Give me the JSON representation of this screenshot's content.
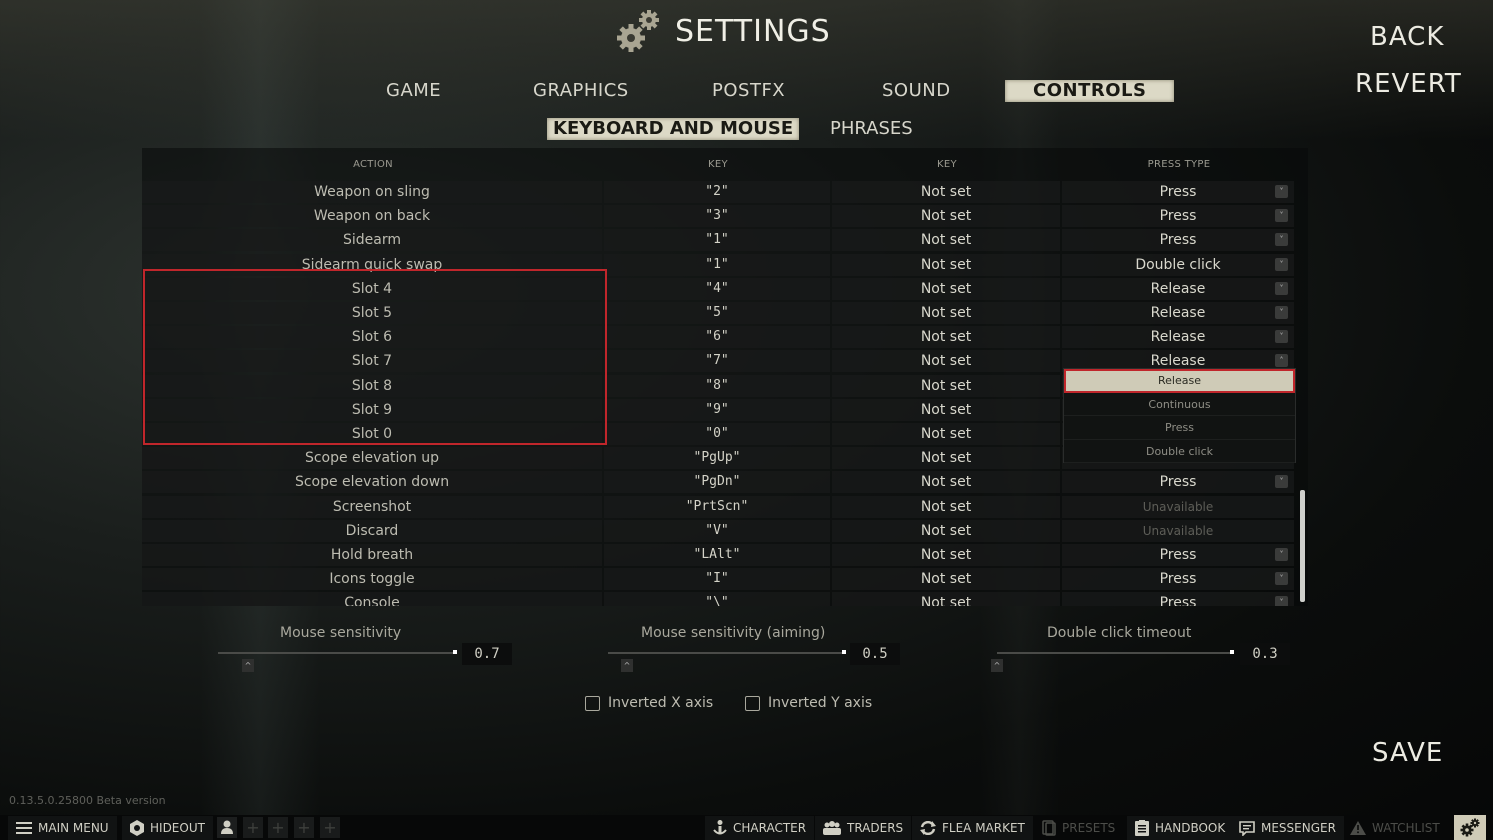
{
  "header": {
    "title": "SETTINGS",
    "icon": "gears-icon"
  },
  "side_actions": {
    "back": "BACK",
    "revert": "REVERT",
    "save": "SAVE"
  },
  "tabs": [
    {
      "label": "GAME",
      "active": false
    },
    {
      "label": "GRAPHICS",
      "active": false
    },
    {
      "label": "POSTFX",
      "active": false
    },
    {
      "label": "SOUND",
      "active": false
    },
    {
      "label": "CONTROLS",
      "active": true
    }
  ],
  "subtabs": [
    {
      "label": "KEYBOARD AND MOUSE",
      "active": true
    },
    {
      "label": "PHRASES",
      "active": false
    }
  ],
  "table": {
    "columns": [
      "ACTION",
      "KEY",
      "KEY",
      "PRESS TYPE"
    ],
    "rows": [
      {
        "action": "Weapon on sling",
        "key1": "\"2\"",
        "key2": "Not set",
        "press": "Press"
      },
      {
        "action": "Weapon on back",
        "key1": "\"3\"",
        "key2": "Not set",
        "press": "Press"
      },
      {
        "action": "Sidearm",
        "key1": "\"1\"",
        "key2": "Not set",
        "press": "Press"
      },
      {
        "action": "Sidearm quick swap",
        "key1": "\"1\"",
        "key2": "Not set",
        "press": "Double click"
      },
      {
        "action": "Slot 4",
        "key1": "\"4\"",
        "key2": "Not set",
        "press": "Release"
      },
      {
        "action": "Slot 5",
        "key1": "\"5\"",
        "key2": "Not set",
        "press": "Release"
      },
      {
        "action": "Slot 6",
        "key1": "\"6\"",
        "key2": "Not set",
        "press": "Release"
      },
      {
        "action": "Slot 7",
        "key1": "\"7\"",
        "key2": "Not set",
        "press": "Release",
        "open": true
      },
      {
        "action": "Slot 8",
        "key1": "\"8\"",
        "key2": "Not set",
        "press": ""
      },
      {
        "action": "Slot 9",
        "key1": "\"9\"",
        "key2": "Not set",
        "press": ""
      },
      {
        "action": "Slot 0",
        "key1": "\"0\"",
        "key2": "Not set",
        "press": ""
      },
      {
        "action": "Scope elevation up",
        "key1": "\"PgUp\"",
        "key2": "Not set",
        "press": ""
      },
      {
        "action": "Scope elevation down",
        "key1": "\"PgDn\"",
        "key2": "Not set",
        "press": "Press"
      },
      {
        "action": "Screenshot",
        "key1": "\"PrtScn\"",
        "key2": "Not set",
        "press": "Unavailable",
        "unavailable": true
      },
      {
        "action": "Discard",
        "key1": "\"V\"",
        "key2": "Not set",
        "press": "Unavailable",
        "unavailable": true
      },
      {
        "action": "Hold breath",
        "key1": "\"LAlt\"",
        "key2": "Not set",
        "press": "Press"
      },
      {
        "action": "Icons toggle",
        "key1": "\"I\"",
        "key2": "Not set",
        "press": "Press"
      },
      {
        "action": "Console",
        "key1": "\"\\\"",
        "key2": "Not set",
        "press": "Press"
      }
    ]
  },
  "dropdown": {
    "options": [
      "Release",
      "Continuous",
      "Press",
      "Double click"
    ],
    "selected": "Release"
  },
  "sliders": [
    {
      "label": "Mouse sensitivity",
      "value": "0.7"
    },
    {
      "label": "Mouse sensitivity (aiming)",
      "value": "0.5"
    },
    {
      "label": "Double click timeout",
      "value": "0.3"
    }
  ],
  "checkboxes": [
    {
      "label": "Inverted X axis",
      "checked": false
    },
    {
      "label": "Inverted Y axis",
      "checked": false
    }
  ],
  "version": "0.13.5.0.25800 Beta version",
  "bottom_bar": {
    "main_menu": "MAIN MENU",
    "hideout": "HIDEOUT",
    "character": "CHARACTER",
    "traders": "TRADERS",
    "flea_market": "FLEA MARKET",
    "presets": "PRESETS",
    "handbook": "HANDBOOK",
    "messenger": "MESSENGER",
    "watchlist": "WATCHLIST"
  },
  "colors": {
    "accent": "#dcd9c6",
    "highlight": "#c0262b"
  }
}
